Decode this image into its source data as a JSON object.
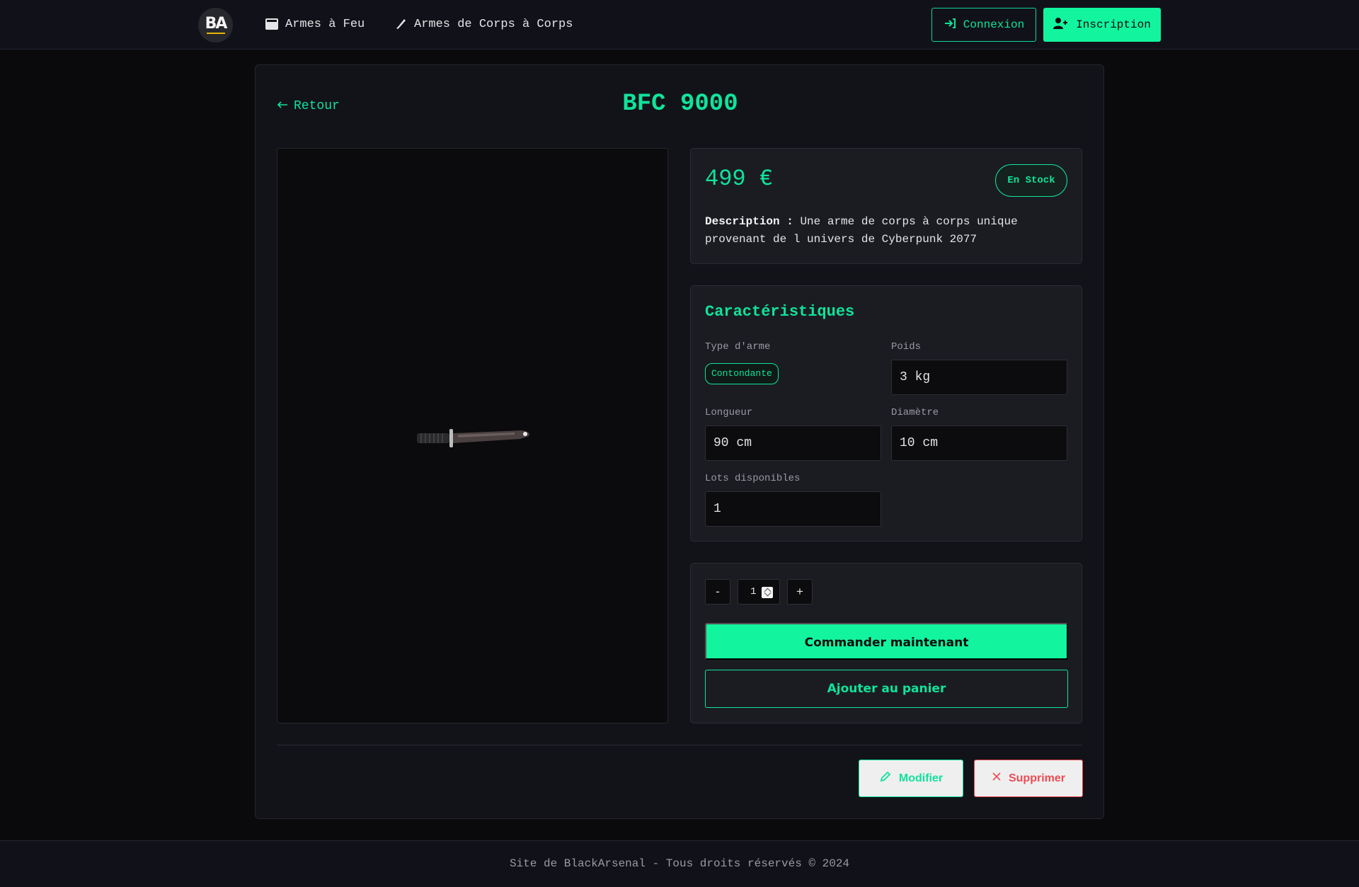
{
  "navbar": {
    "logo_text": "BA",
    "links": [
      {
        "label": "Armes à Feu",
        "icon": "film-icon"
      },
      {
        "label": "Armes de Corps à Corps",
        "icon": "knife-icon"
      }
    ],
    "login_label": "Connexion",
    "signup_label": "Inscription"
  },
  "product": {
    "back_label": "Retour",
    "title": "BFC 9000",
    "price": "499 €",
    "stock_badge": "En Stock",
    "description_label": "Description :",
    "description": "Une arme de corps à corps unique provenant de l univers de Cyberpunk 2077"
  },
  "characteristics": {
    "title": "Caractéristiques",
    "type_label": "Type d'arme",
    "type_value": "Contondante",
    "weight_label": "Poids",
    "weight_value": "3 kg",
    "length_label": "Longueur",
    "length_value": "90 cm",
    "diameter_label": "Diamètre",
    "diameter_value": "10 cm",
    "lots_label": "Lots disponibles",
    "lots_value": "1"
  },
  "order": {
    "minus_label": "-",
    "quantity": "1",
    "plus_label": "+",
    "order_button": "Commander maintenant",
    "cart_button": "Ajouter au panier"
  },
  "admin": {
    "edit_label": "Modifier",
    "delete_label": "Supprimer"
  },
  "footer": {
    "text": "Site de BlackArsenal - Tous droits réservés © 2024"
  },
  "colors": {
    "accent": "#12f59e",
    "danger": "#ef4b52",
    "background": "#0a0a0c",
    "panel": "#1b1c22"
  }
}
